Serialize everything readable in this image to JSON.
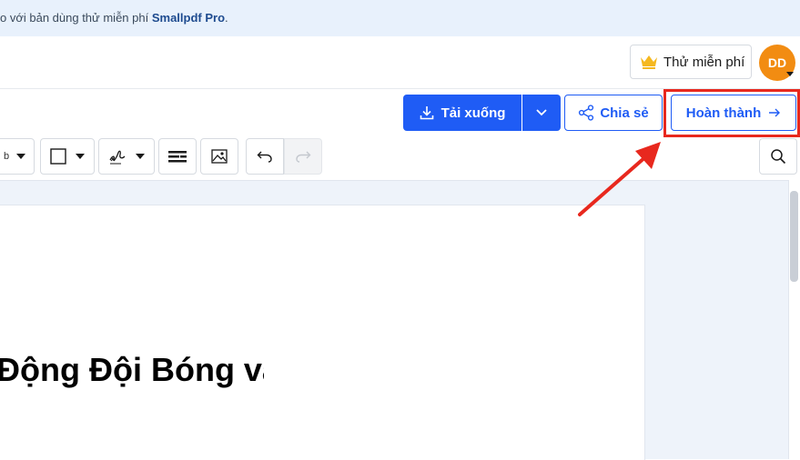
{
  "banner": {
    "text_prefix": "o với bản dùng thử miễn phí ",
    "brand": "Smallpdf Pro",
    "text_suffix": "."
  },
  "topbar": {
    "trial_label": "Thử miễn phí",
    "avatar_initials": "DD"
  },
  "actions": {
    "download_label": "Tải xuống",
    "share_label": "Chia sẻ",
    "done_label": "Hoàn thành"
  },
  "toolbar": {
    "text_tool_fragment": "b"
  },
  "document": {
    "visible_text": "Động Đội Bóng và"
  },
  "colors": {
    "primary": "#1f5cf5",
    "highlight": "#e8281e",
    "avatar": "#f28c12",
    "banner_bg": "#e8f1fc",
    "crown": "#f5b820"
  },
  "icons": [
    "crown-icon",
    "download-icon",
    "chevron-down-icon",
    "share-icon",
    "arrow-right-icon",
    "square-icon",
    "signature-icon",
    "form-fields-icon",
    "image-icon",
    "undo-icon",
    "redo-icon",
    "search-icon"
  ]
}
